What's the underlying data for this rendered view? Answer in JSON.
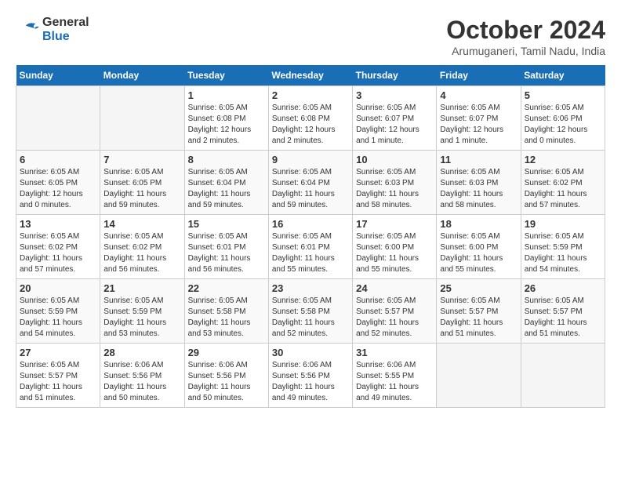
{
  "header": {
    "logo": {
      "line1": "General",
      "line2": "Blue"
    },
    "title": "October 2024",
    "subtitle": "Arumuganeri, Tamil Nadu, India"
  },
  "calendar": {
    "weekdays": [
      "Sunday",
      "Monday",
      "Tuesday",
      "Wednesday",
      "Thursday",
      "Friday",
      "Saturday"
    ],
    "weeks": [
      [
        {
          "day": "",
          "info": ""
        },
        {
          "day": "",
          "info": ""
        },
        {
          "day": "1",
          "info": "Sunrise: 6:05 AM\nSunset: 6:08 PM\nDaylight: 12 hours\nand 2 minutes."
        },
        {
          "day": "2",
          "info": "Sunrise: 6:05 AM\nSunset: 6:08 PM\nDaylight: 12 hours\nand 2 minutes."
        },
        {
          "day": "3",
          "info": "Sunrise: 6:05 AM\nSunset: 6:07 PM\nDaylight: 12 hours\nand 1 minute."
        },
        {
          "day": "4",
          "info": "Sunrise: 6:05 AM\nSunset: 6:07 PM\nDaylight: 12 hours\nand 1 minute."
        },
        {
          "day": "5",
          "info": "Sunrise: 6:05 AM\nSunset: 6:06 PM\nDaylight: 12 hours\nand 0 minutes."
        }
      ],
      [
        {
          "day": "6",
          "info": "Sunrise: 6:05 AM\nSunset: 6:05 PM\nDaylight: 12 hours\nand 0 minutes."
        },
        {
          "day": "7",
          "info": "Sunrise: 6:05 AM\nSunset: 6:05 PM\nDaylight: 11 hours\nand 59 minutes."
        },
        {
          "day": "8",
          "info": "Sunrise: 6:05 AM\nSunset: 6:04 PM\nDaylight: 11 hours\nand 59 minutes."
        },
        {
          "day": "9",
          "info": "Sunrise: 6:05 AM\nSunset: 6:04 PM\nDaylight: 11 hours\nand 59 minutes."
        },
        {
          "day": "10",
          "info": "Sunrise: 6:05 AM\nSunset: 6:03 PM\nDaylight: 11 hours\nand 58 minutes."
        },
        {
          "day": "11",
          "info": "Sunrise: 6:05 AM\nSunset: 6:03 PM\nDaylight: 11 hours\nand 58 minutes."
        },
        {
          "day": "12",
          "info": "Sunrise: 6:05 AM\nSunset: 6:02 PM\nDaylight: 11 hours\nand 57 minutes."
        }
      ],
      [
        {
          "day": "13",
          "info": "Sunrise: 6:05 AM\nSunset: 6:02 PM\nDaylight: 11 hours\nand 57 minutes."
        },
        {
          "day": "14",
          "info": "Sunrise: 6:05 AM\nSunset: 6:02 PM\nDaylight: 11 hours\nand 56 minutes."
        },
        {
          "day": "15",
          "info": "Sunrise: 6:05 AM\nSunset: 6:01 PM\nDaylight: 11 hours\nand 56 minutes."
        },
        {
          "day": "16",
          "info": "Sunrise: 6:05 AM\nSunset: 6:01 PM\nDaylight: 11 hours\nand 55 minutes."
        },
        {
          "day": "17",
          "info": "Sunrise: 6:05 AM\nSunset: 6:00 PM\nDaylight: 11 hours\nand 55 minutes."
        },
        {
          "day": "18",
          "info": "Sunrise: 6:05 AM\nSunset: 6:00 PM\nDaylight: 11 hours\nand 55 minutes."
        },
        {
          "day": "19",
          "info": "Sunrise: 6:05 AM\nSunset: 5:59 PM\nDaylight: 11 hours\nand 54 minutes."
        }
      ],
      [
        {
          "day": "20",
          "info": "Sunrise: 6:05 AM\nSunset: 5:59 PM\nDaylight: 11 hours\nand 54 minutes."
        },
        {
          "day": "21",
          "info": "Sunrise: 6:05 AM\nSunset: 5:59 PM\nDaylight: 11 hours\nand 53 minutes."
        },
        {
          "day": "22",
          "info": "Sunrise: 6:05 AM\nSunset: 5:58 PM\nDaylight: 11 hours\nand 53 minutes."
        },
        {
          "day": "23",
          "info": "Sunrise: 6:05 AM\nSunset: 5:58 PM\nDaylight: 11 hours\nand 52 minutes."
        },
        {
          "day": "24",
          "info": "Sunrise: 6:05 AM\nSunset: 5:57 PM\nDaylight: 11 hours\nand 52 minutes."
        },
        {
          "day": "25",
          "info": "Sunrise: 6:05 AM\nSunset: 5:57 PM\nDaylight: 11 hours\nand 51 minutes."
        },
        {
          "day": "26",
          "info": "Sunrise: 6:05 AM\nSunset: 5:57 PM\nDaylight: 11 hours\nand 51 minutes."
        }
      ],
      [
        {
          "day": "27",
          "info": "Sunrise: 6:05 AM\nSunset: 5:57 PM\nDaylight: 11 hours\nand 51 minutes."
        },
        {
          "day": "28",
          "info": "Sunrise: 6:06 AM\nSunset: 5:56 PM\nDaylight: 11 hours\nand 50 minutes."
        },
        {
          "day": "29",
          "info": "Sunrise: 6:06 AM\nSunset: 5:56 PM\nDaylight: 11 hours\nand 50 minutes."
        },
        {
          "day": "30",
          "info": "Sunrise: 6:06 AM\nSunset: 5:56 PM\nDaylight: 11 hours\nand 49 minutes."
        },
        {
          "day": "31",
          "info": "Sunrise: 6:06 AM\nSunset: 5:55 PM\nDaylight: 11 hours\nand 49 minutes."
        },
        {
          "day": "",
          "info": ""
        },
        {
          "day": "",
          "info": ""
        }
      ]
    ]
  }
}
